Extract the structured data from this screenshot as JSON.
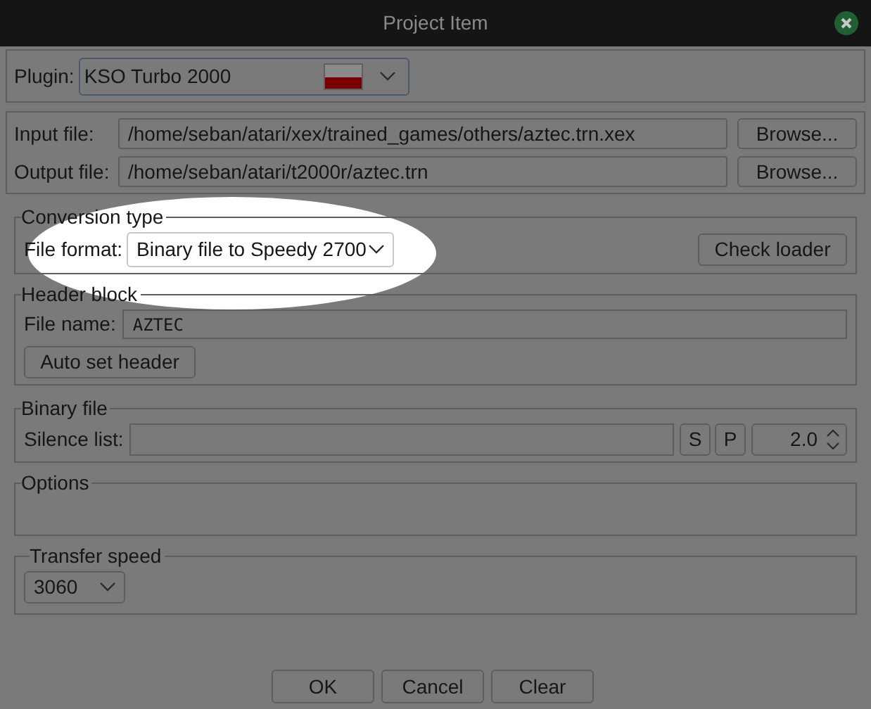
{
  "window": {
    "title": "Project Item"
  },
  "plugin": {
    "label": "Plugin:",
    "value": "KSO Turbo 2000"
  },
  "files": [
    {
      "label": "Input file:",
      "value": "/home/seban/atari/xex/trained_games/others/aztec.trn.xex",
      "button": "Browse..."
    },
    {
      "label": "Output file:",
      "value": "/home/seban/atari/t2000r/aztec.trn",
      "button": "Browse..."
    }
  ],
  "conversion_type": {
    "title": "Conversion type",
    "label": "File format:",
    "value": "Binary file to Speedy 2700",
    "button": "Check loader",
    "highlighted": true
  },
  "header_block": {
    "title": "Header block",
    "label": "File name:",
    "value": "AZTEC",
    "button": "Auto set header"
  },
  "binary_file": {
    "title": "Binary file",
    "label": "Silence list:",
    "buttons": [
      "S",
      "P"
    ],
    "spin_value": "2.0"
  },
  "options": {
    "title": "Options"
  },
  "transfer_speed": {
    "title": "Transfer speed",
    "value": "3060"
  },
  "buttons": [
    "OK",
    "Cancel",
    "Clear"
  ]
}
